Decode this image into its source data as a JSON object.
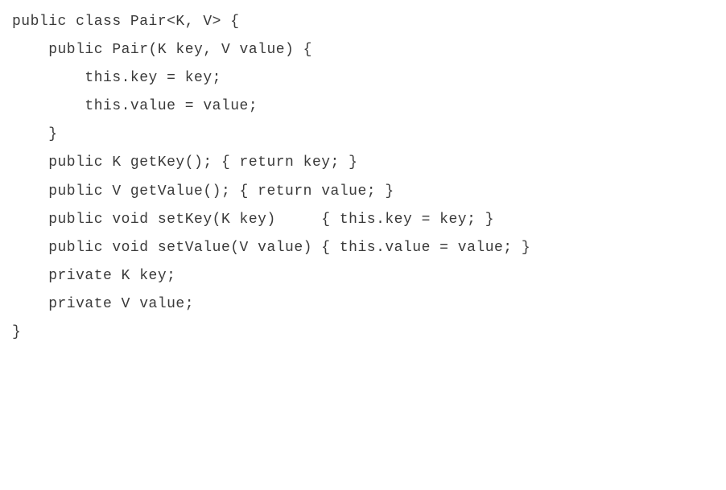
{
  "code": {
    "lines": [
      "public class Pair<K, V> {",
      "",
      "    public Pair(K key, V value) {",
      "        this.key = key;",
      "        this.value = value;",
      "    }",
      "",
      "    public K getKey(); { return key; }",
      "    public V getValue(); { return value; }",
      "",
      "    public void setKey(K key)     { this.key = key; }",
      "    public void setValue(V value) { this.value = value; }",
      "",
      "    private K key;",
      "    private V value;",
      "}"
    ]
  }
}
